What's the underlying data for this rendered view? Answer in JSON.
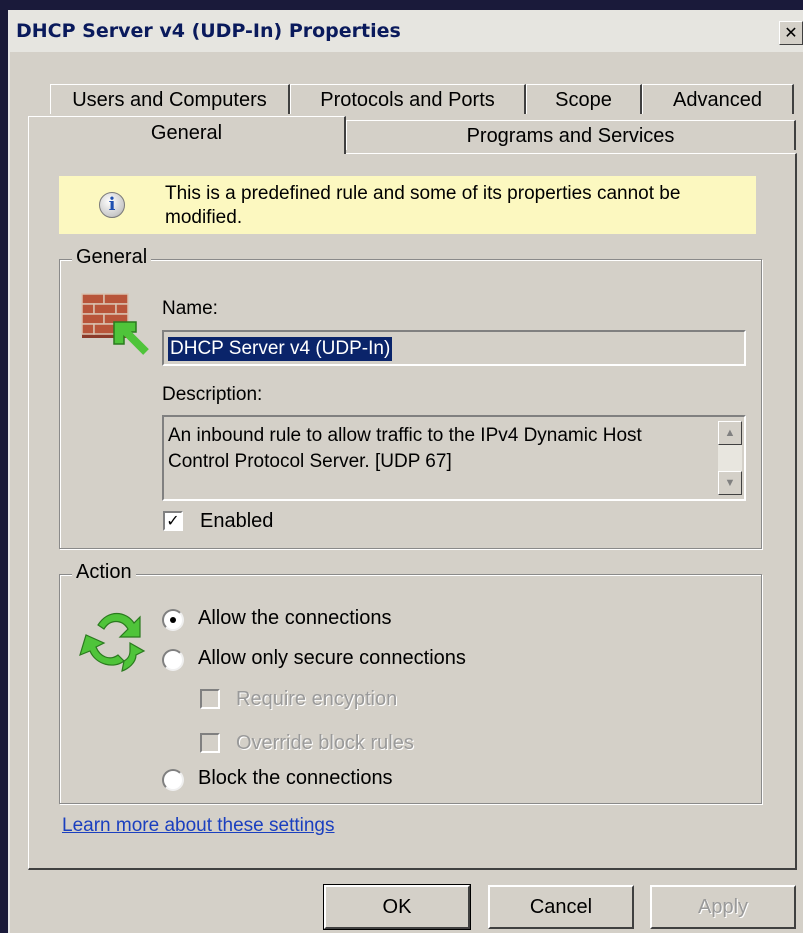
{
  "window": {
    "title": "DHCP Server v4 (UDP-In) Properties",
    "close_glyph": "✕"
  },
  "tabs": {
    "row1": [
      "Users and Computers",
      "Protocols and Ports",
      "Scope",
      "Advanced"
    ],
    "row2": [
      "General",
      "Programs and Services"
    ],
    "active": "General"
  },
  "info_banner": {
    "icon": "info-icon",
    "text": "This is a predefined rule and some of its properties cannot be modified."
  },
  "general_group": {
    "legend": "General",
    "name_label": "Name:",
    "name_value": "DHCP Server v4 (UDP-In)",
    "description_label": "Description:",
    "description_value": "An inbound rule to allow traffic to the IPv4 Dynamic Host Control Protocol Server. [UDP 67]",
    "enabled_label": "Enabled",
    "enabled_checked": true,
    "icon": "firewall-icon"
  },
  "action_group": {
    "legend": "Action",
    "icon": "recycle-arrows-icon",
    "options": [
      {
        "label": "Allow the connections",
        "checked": true
      },
      {
        "label": "Allow only secure connections",
        "checked": false
      },
      {
        "label": "Block the connections",
        "checked": false
      }
    ],
    "sub_options": [
      {
        "label": "Require encyption",
        "enabled": false
      },
      {
        "label": "Override block rules",
        "enabled": false
      }
    ]
  },
  "learn_more_link": "Learn more about these settings",
  "buttons": {
    "ok": "OK",
    "cancel": "Cancel",
    "apply": "Apply"
  },
  "colors": {
    "dialog_bg": "#d4d0c8",
    "banner_bg": "#fcf8c0",
    "selection_bg": "#0a246a",
    "link": "#1a3fbf"
  }
}
